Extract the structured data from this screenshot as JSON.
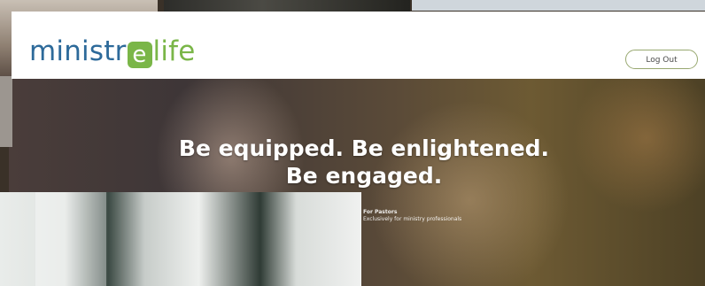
{
  "header": {
    "logo_part1": "ministr",
    "logo_mark": "e",
    "logo_part2": "life",
    "logout_label": "Log Out"
  },
  "hero": {
    "headline_line1": "Be equipped. Be enlightened.",
    "headline_line2": "Be engaged.",
    "feature_title": "For Pastors",
    "feature_text": "Exclusively for ministry professionals"
  },
  "colors": {
    "brand_blue": "#2d6a9a",
    "brand_green": "#7ab648",
    "header_bg": "#ffffff"
  }
}
